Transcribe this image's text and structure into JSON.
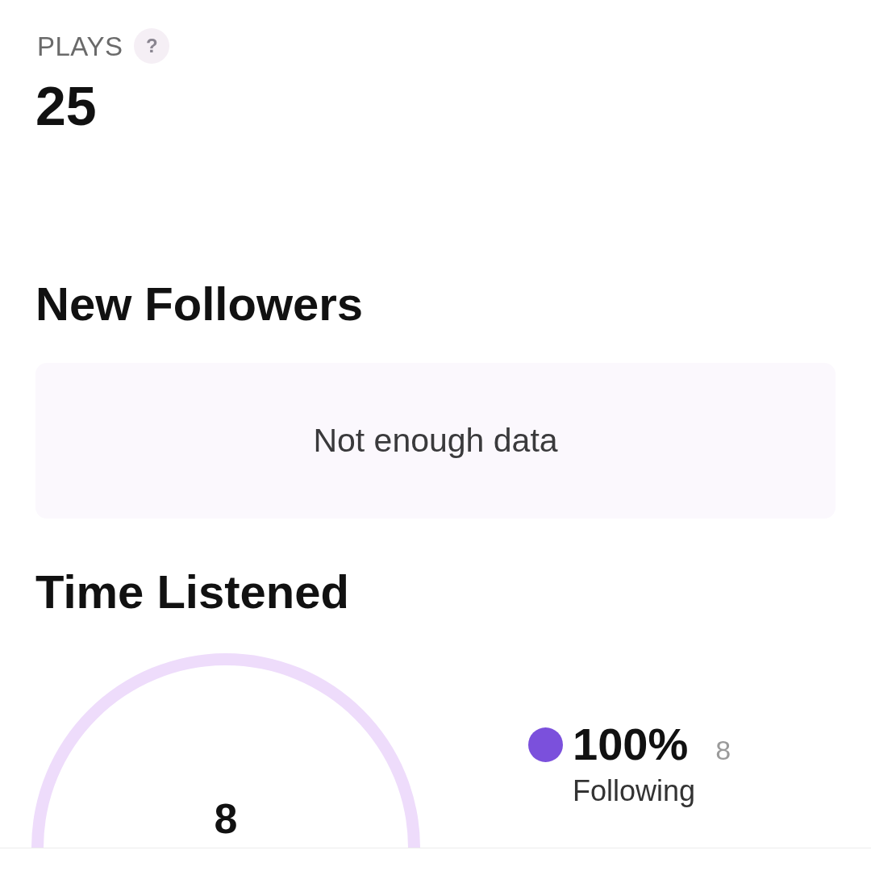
{
  "plays": {
    "label": "PLAYS",
    "help": "?",
    "value": "25"
  },
  "new_followers": {
    "title": "New Followers",
    "empty_message": "Not enough data"
  },
  "time_listened": {
    "title": "Time Listened",
    "center_value": "8",
    "legend": [
      {
        "percent": "100%",
        "count": "8",
        "label": "Following",
        "color": "#7b50dc"
      }
    ]
  }
}
